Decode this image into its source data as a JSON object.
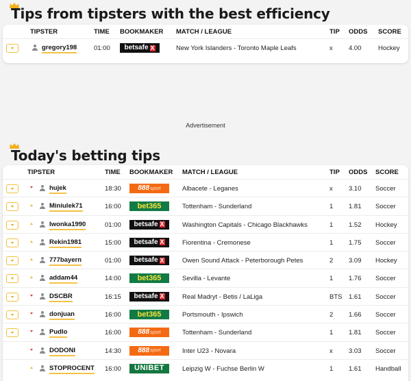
{
  "best": {
    "title": "Tips from tipsters with the best efficiency",
    "headers": {
      "tipster": "TIPSTER",
      "time": "TIME",
      "bookmaker": "BOOKMAKER",
      "match": "MATCH / LEAGUE",
      "tip": "TIP",
      "odds": "ODDS",
      "score": "SCORE"
    },
    "rows": [
      {
        "tipster": "gregory198",
        "time": "01:00",
        "bookmaker": "betsafe",
        "match": "New York Islanders - Toronto Maple Leafs",
        "tip": "x",
        "odds": "4.00",
        "score": "Hockey"
      }
    ]
  },
  "advertisement": "Advertisement",
  "today": {
    "title": "Today's betting tips",
    "headers": {
      "tipster": "TIPSTER",
      "time": "TIME",
      "bookmaker": "BOOKMAKER",
      "match": "MATCH / LEAGUE",
      "tip": "TIP",
      "odds": "ODDS",
      "score": "SCORE"
    },
    "rows": [
      {
        "tipster": "hujek",
        "trend": "down",
        "checkbox": true,
        "time": "18:30",
        "bookmaker": "888sport",
        "match": "Albacete - Leganes",
        "tip": "x",
        "odds": "3.10",
        "score": "Soccer"
      },
      {
        "tipster": "Miniulek71",
        "trend": "up",
        "checkbox": true,
        "time": "16:00",
        "bookmaker": "bet365",
        "match": "Tottenham - Sunderland",
        "tip": "1",
        "odds": "1.81",
        "score": "Soccer"
      },
      {
        "tipster": "Iwonka1990",
        "trend": "up",
        "checkbox": true,
        "time": "01:00",
        "bookmaker": "betsafe",
        "match": "Washington Capitals - Chicago Blackhawks",
        "tip": "1",
        "odds": "1.52",
        "score": "Hockey"
      },
      {
        "tipster": "Rekin1981",
        "trend": "up",
        "checkbox": true,
        "time": "15:00",
        "bookmaker": "betsafe",
        "match": "Fiorentina - Cremonese",
        "tip": "1",
        "odds": "1.75",
        "score": "Soccer"
      },
      {
        "tipster": "777bayern",
        "trend": "up",
        "checkbox": true,
        "time": "01:00",
        "bookmaker": "betsafe",
        "match": "Owen Sound Attack - Peterborough Petes",
        "tip": "2",
        "odds": "3.09",
        "score": "Hockey"
      },
      {
        "tipster": "addam44",
        "trend": "up",
        "checkbox": true,
        "time": "14:00",
        "bookmaker": "bet365",
        "match": "Sevilla - Levante",
        "tip": "1",
        "odds": "1.76",
        "score": "Soccer"
      },
      {
        "tipster": "DSCBR",
        "trend": "down",
        "checkbox": true,
        "time": "16:15",
        "bookmaker": "betsafe",
        "match": "Real Madryt - Betis / LaLiga",
        "tip": "BTS",
        "odds": "1.61",
        "score": "Soccer"
      },
      {
        "tipster": "donjuan",
        "trend": "down",
        "checkbox": true,
        "time": "16:00",
        "bookmaker": "bet365",
        "match": "Portsmouth - Ipswich",
        "tip": "2",
        "odds": "1.66",
        "score": "Soccer"
      },
      {
        "tipster": "Pudlo",
        "trend": "down",
        "checkbox": true,
        "time": "16:00",
        "bookmaker": "888sport",
        "match": "Tottenham - Sunderland",
        "tip": "1",
        "odds": "1.81",
        "score": "Soccer"
      },
      {
        "tipster": "DODONI",
        "trend": "down",
        "checkbox": false,
        "time": "14:30",
        "bookmaker": "888sport",
        "match": "Inter U23 - Novara",
        "tip": "x",
        "odds": "3.03",
        "score": "Soccer"
      },
      {
        "tipster": "STOPROCENT",
        "trend": "up",
        "checkbox": false,
        "time": "16:00",
        "bookmaker": "unibet",
        "match": "Leipzig W - Fuchse Berlin W",
        "tip": "1",
        "odds": "1.61",
        "score": "Handball"
      }
    ]
  },
  "bookmaker_logos": {
    "betsafe": {
      "text": "betsafe",
      "mark": "X"
    },
    "888sport": {
      "text": "888",
      "mark": "sport"
    },
    "bet365": {
      "text": "bet365",
      "mark": ""
    },
    "unibet": {
      "text": "UNIBET",
      "mark": ""
    }
  },
  "colors": {
    "accent": "#f5c242",
    "trend_up": "#f0b429",
    "trend_down": "#e23b3b",
    "betsafe_red": "#e0262b",
    "888_orange": "#f46a13",
    "bet365_green": "#127b45"
  }
}
